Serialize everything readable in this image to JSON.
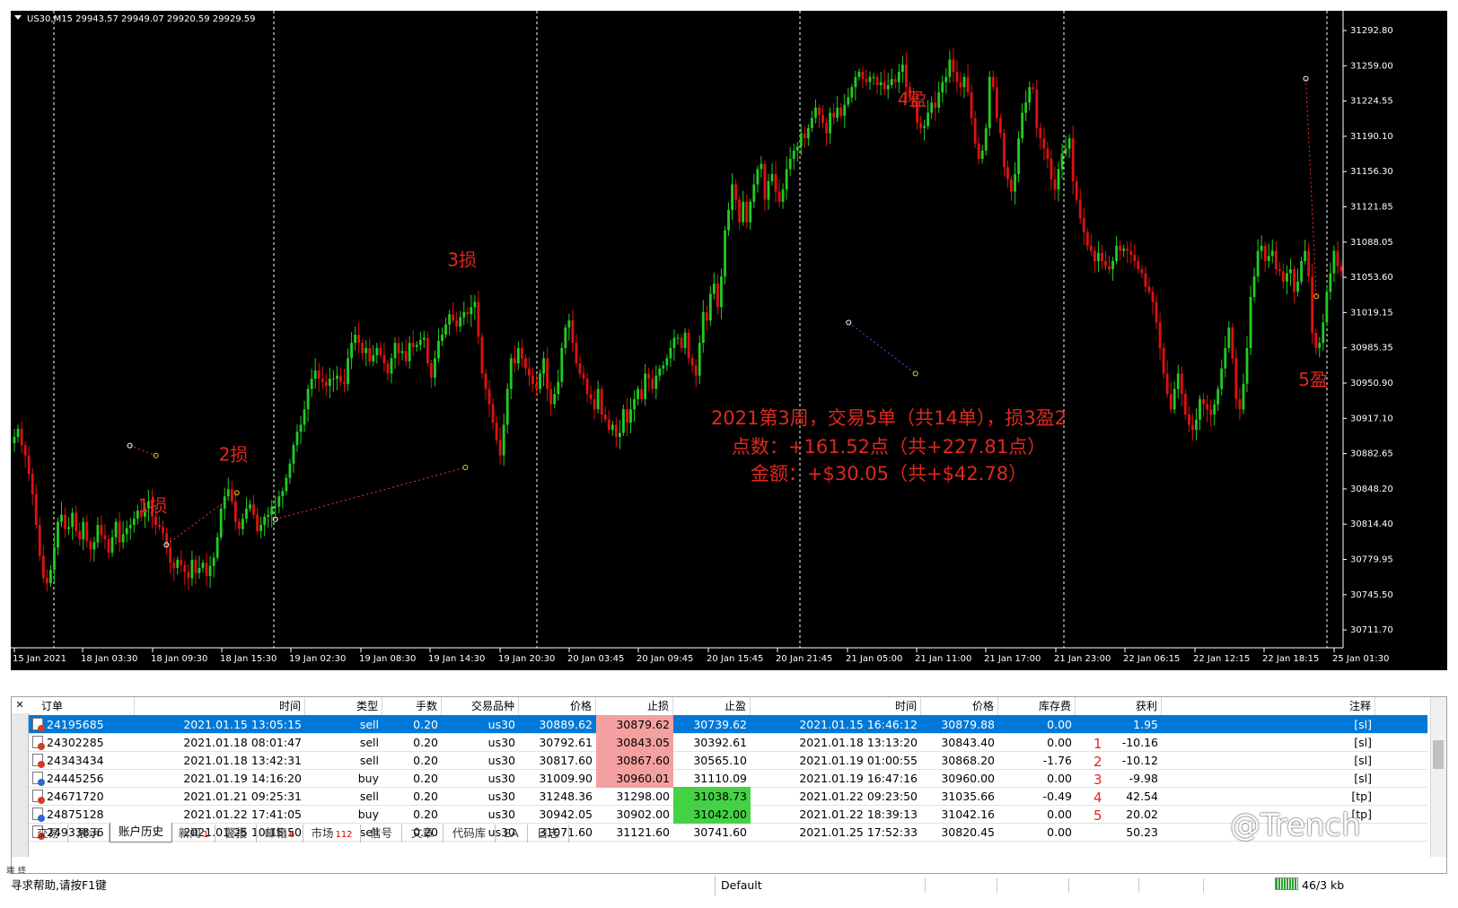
{
  "chart": {
    "header": "US30,M15  29943.57 29949.07 29920.59 29929.59",
    "price_axis": [
      "31292.80",
      "31259.00",
      "31224.55",
      "31190.10",
      "31156.30",
      "31121.85",
      "31088.05",
      "31053.60",
      "31019.15",
      "30985.35",
      "30950.90",
      "30917.10",
      "30882.65",
      "30848.20",
      "30814.40",
      "30779.95",
      "30745.50",
      "30711.70"
    ],
    "time_axis": [
      "15 Jan 2021",
      "18 Jan 03:30",
      "18 Jan 09:30",
      "18 Jan 15:30",
      "19 Jan 02:30",
      "19 Jan 08:30",
      "19 Jan 14:30",
      "19 Jan 20:30",
      "20 Jan 03:45",
      "20 Jan 09:45",
      "20 Jan 15:45",
      "20 Jan 21:45",
      "21 Jan 05:00",
      "21 Jan 11:00",
      "21 Jan 17:00",
      "21 Jan 23:00",
      "22 Jan 06:15",
      "22 Jan 12:15",
      "22 Jan 18:15",
      "25 Jan 01:30"
    ],
    "annotations": [
      {
        "text": "1损",
        "price": 30825,
        "slot": 1.45
      },
      {
        "text": "2损",
        "price": 30875,
        "slot": 2.6
      },
      {
        "text": "3损",
        "price": 31065,
        "slot": 5.85
      },
      {
        "text": "4盈",
        "price": 31222,
        "slot": 12.25
      },
      {
        "text": "5盈",
        "price": 30948,
        "slot": 17.95
      }
    ],
    "summary": [
      "2021第3周，交易5单（共14单），损3盈2",
      "点数：+161.52点（共+227.81点）",
      "金额：+$30.05（共+$42.78）"
    ],
    "colors": {
      "bg": "#000000",
      "bull": "#22cc22",
      "bear": "#dd1111",
      "text_annot": "#e0281e",
      "grid": "#ffffff",
      "axis_text": "#ffffff"
    }
  },
  "table": {
    "headers": {
      "order": "订单",
      "open_time": "时间",
      "type": "类型",
      "lots": "手数",
      "symbol": "交易品种",
      "open_price": "价格",
      "sl": "止损",
      "tp": "止盈",
      "close_time": "时间",
      "close_price": "价格",
      "swap": "库存费",
      "profit": "获利",
      "comment": "注释"
    },
    "rows": [
      {
        "order": "24195685",
        "open_time": "2021.01.15 13:05:15",
        "type": "sell",
        "lots": "0.20",
        "symbol": "us30",
        "open_price": "30889.62",
        "sl": "30879.62",
        "tp": "30739.62",
        "close_time": "2021.01.15 16:46:12",
        "close_price": "30879.88",
        "swap": "0.00",
        "profit": "1.95",
        "comment": "[sl]",
        "mark": "",
        "selected": true,
        "hl": "sl"
      },
      {
        "order": "24302285",
        "open_time": "2021.01.18 08:01:47",
        "type": "sell",
        "lots": "0.20",
        "symbol": "us30",
        "open_price": "30792.61",
        "sl": "30843.05",
        "tp": "30392.61",
        "close_time": "2021.01.18 13:13:20",
        "close_price": "30843.40",
        "swap": "0.00",
        "profit": "-10.16",
        "comment": "[sl]",
        "mark": "1",
        "selected": false,
        "hl": "sl"
      },
      {
        "order": "24343434",
        "open_time": "2021.01.18 13:42:31",
        "type": "sell",
        "lots": "0.20",
        "symbol": "us30",
        "open_price": "30817.60",
        "sl": "30867.60",
        "tp": "30565.10",
        "close_time": "2021.01.19 01:00:55",
        "close_price": "30868.20",
        "swap": "-1.76",
        "profit": "-10.12",
        "comment": "[sl]",
        "mark": "2",
        "selected": false,
        "hl": "sl"
      },
      {
        "order": "24445256",
        "open_time": "2021.01.19 14:16:20",
        "type": "buy",
        "lots": "0.20",
        "symbol": "us30",
        "open_price": "31009.90",
        "sl": "30960.01",
        "tp": "31110.09",
        "close_time": "2021.01.19 16:47:16",
        "close_price": "30960.00",
        "swap": "0.00",
        "profit": "-9.98",
        "comment": "[sl]",
        "mark": "3",
        "selected": false,
        "hl": "sl"
      },
      {
        "order": "24671720",
        "open_time": "2021.01.21 09:25:31",
        "type": "sell",
        "lots": "0.20",
        "symbol": "us30",
        "open_price": "31248.36",
        "sl": "31298.00",
        "tp": "31038.73",
        "close_time": "2021.01.22 09:23:50",
        "close_price": "31035.66",
        "swap": "-0.49",
        "profit": "42.54",
        "comment": "[tp]",
        "mark": "4",
        "selected": false,
        "hl": "tp"
      },
      {
        "order": "24875128",
        "open_time": "2021.01.22 17:41:05",
        "type": "buy",
        "lots": "0.20",
        "symbol": "us30",
        "open_price": "30942.05",
        "sl": "30902.00",
        "tp": "31042.00",
        "close_time": "2021.01.22 18:39:13",
        "close_price": "31042.16",
        "swap": "0.00",
        "profit": "20.02",
        "comment": "[tp]",
        "mark": "5",
        "selected": false,
        "hl": "tp"
      },
      {
        "order": "24933836",
        "open_time": "2021.01.25 10:15:50",
        "type": "sell",
        "lots": "0.20",
        "symbol": "us30",
        "open_price": "31071.60",
        "sl": "31121.60",
        "tp": "30741.60",
        "close_time": "2021.01.25 17:52:33",
        "close_price": "30820.45",
        "swap": "0.00",
        "profit": "50.23",
        "comment": "",
        "mark": "",
        "selected": false,
        "hl": ""
      }
    ]
  },
  "tabs": [
    {
      "label": "交易",
      "badge": ""
    },
    {
      "label": "展示",
      "badge": ""
    },
    {
      "label": "账户历史",
      "badge": "",
      "active": true
    },
    {
      "label": "新闻",
      "badge": "1"
    },
    {
      "label": "警报",
      "badge": ""
    },
    {
      "label": "邮箱",
      "badge": "6"
    },
    {
      "label": "市场",
      "badge": "112"
    },
    {
      "label": "信号",
      "badge": ""
    },
    {
      "label": "文章",
      "badge": ""
    },
    {
      "label": "代码库",
      "badge": ""
    },
    {
      "label": "EA",
      "badge": ""
    },
    {
      "label": "日志",
      "badge": ""
    }
  ],
  "side_label": "终端",
  "close_glyph": "✕",
  "status": {
    "help": "寻求帮助,请按F1键",
    "profile": "Default",
    "traffic": "46/3 kb"
  },
  "watermark": "@Trench",
  "candles": [
    30898,
    30906,
    30890,
    30880,
    30862,
    30842,
    30812,
    30782,
    30760,
    30755,
    30768,
    30790,
    30815,
    30822,
    30808,
    30810,
    30824,
    30806,
    30798,
    30815,
    30796,
    30788,
    30795,
    30812,
    30802,
    30798,
    30785,
    30800,
    30815,
    30795,
    30803,
    30809,
    30812,
    30818,
    30826,
    30820,
    30828,
    30835,
    30820,
    30812,
    30810,
    30804,
    30790,
    30775,
    30770,
    30778,
    30773,
    30766,
    30760,
    30778,
    30765,
    30770,
    30775,
    30762,
    30772,
    30780,
    30800,
    30828,
    30840,
    30847,
    30835,
    30815,
    30808,
    30818,
    30828,
    30832,
    30822,
    30806,
    30812,
    30820,
    30822,
    30830,
    30830,
    30840,
    30845,
    30858,
    30872,
    30890,
    30903,
    30910,
    30925,
    30945,
    30955,
    30963,
    30955,
    30952,
    30948,
    30955,
    30955,
    30958,
    30952,
    30950,
    30975,
    30990,
    30998,
    30990,
    30980,
    30985,
    30972,
    30978,
    30985,
    30978,
    30970,
    30960,
    30975,
    30990,
    30980,
    30982,
    30972,
    30990,
    30986,
    30988,
    30993,
    30995,
    30970,
    30956,
    30975,
    30992,
    30998,
    31008,
    31018,
    31012,
    31006,
    31015,
    31020,
    31018,
    31025,
    31030,
    30996,
    30960,
    30945,
    30930,
    30912,
    30895,
    30880,
    30910,
    30945,
    30975,
    30970,
    30985,
    30975,
    30965,
    30958,
    30950,
    30945,
    30960,
    30975,
    30945,
    30930,
    30940,
    30952,
    30985,
    31005,
    31012,
    30990,
    30970,
    30960,
    30955,
    30940,
    30935,
    30925,
    30945,
    30920,
    30915,
    30905,
    30910,
    30898,
    30902,
    30925,
    30912,
    30925,
    30935,
    30945,
    30935,
    30960,
    30955,
    30945,
    30958,
    30965,
    30968,
    30975,
    30985,
    30995,
    30995,
    30985,
    31000,
    30975,
    30968,
    30958,
    30990,
    31020,
    31012,
    31038,
    31048,
    31025,
    31055,
    31100,
    31120,
    31145,
    31130,
    31108,
    31128,
    31108,
    31128,
    31145,
    31160,
    31165,
    31130,
    31148,
    31155,
    31138,
    31128,
    31140,
    31160,
    31170,
    31178,
    31182,
    31195,
    31190,
    31200,
    31210,
    31220,
    31213,
    31205,
    31195,
    31215,
    31210,
    31220,
    31212,
    31223,
    31230,
    31240,
    31250,
    31255,
    31248,
    31245,
    31250,
    31250,
    31242,
    31245,
    31238,
    31242,
    31248,
    31245,
    31255,
    31262,
    31240,
    31230,
    31225,
    31205,
    31200,
    31202,
    31215,
    31225,
    31220,
    31235,
    31245,
    31250,
    31267,
    31255,
    31245,
    31240,
    31250,
    31235,
    31210,
    31185,
    31170,
    31178,
    31200,
    31250,
    31240,
    31210,
    31195,
    31162,
    31150,
    31138,
    31155,
    31190,
    31215,
    31225,
    31240,
    31238,
    31200,
    31190,
    31180,
    31170,
    31150,
    31140,
    31160,
    31175,
    31180,
    31190,
    31148,
    31130,
    31112,
    31098,
    31085,
    31080,
    31070,
    31078,
    31070,
    31065,
    31062,
    31070,
    31085,
    31080,
    31082,
    31080,
    31076,
    31070,
    31062,
    31058,
    31045,
    31040,
    31030,
    31010,
    30985,
    30960,
    30940,
    30925,
    30945,
    30960,
    30940,
    30920,
    30910,
    30905,
    30915,
    30935,
    30930,
    30925,
    30920,
    30930,
    30945,
    30965,
    30985,
    31005,
    30975,
    30935,
    30925,
    30950,
    30985,
    31035,
    31055,
    31080,
    31085,
    31070,
    31075,
    31080,
    31062,
    31060,
    31050,
    31058,
    31062,
    31040,
    31050,
    31070,
    31080,
    31055,
    31000,
    30985,
    30990,
    31010,
    31040,
    31058,
    31080,
    31065,
    31060
  ]
}
